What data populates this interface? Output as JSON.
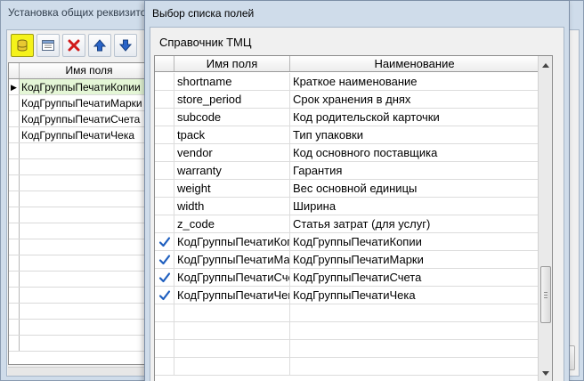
{
  "background_window": {
    "title": "Установка общих реквизито",
    "toolbar": [
      {
        "icon": "database-icon",
        "active": true
      },
      {
        "icon": "form-icon",
        "active": false
      },
      {
        "icon": "delete-icon",
        "active": false
      },
      {
        "icon": "arrow-up-icon",
        "active": false
      },
      {
        "icon": "arrow-down-icon",
        "active": false
      }
    ],
    "grid": {
      "header": "Имя поля",
      "rows": [
        {
          "value": "КодГруппыПечатиКопии",
          "current": true
        },
        {
          "value": "КодГруппыПечатиМарки",
          "current": false
        },
        {
          "value": "КодГруппыПечатиСчета",
          "current": false
        },
        {
          "value": "КодГруппыПечатиЧека",
          "current": false
        }
      ],
      "current_marker": "▶"
    }
  },
  "dialog": {
    "title": "Выбор списка полей",
    "label": "Справочник ТМЦ",
    "columns": {
      "name": "Имя поля",
      "desc": "Наименование"
    },
    "rows": [
      {
        "checked": false,
        "name": "shortname",
        "desc": "Краткое наименование"
      },
      {
        "checked": false,
        "name": "store_period",
        "desc": "Срок хранения в днях"
      },
      {
        "checked": false,
        "name": "subcode",
        "desc": "Код родительской карточки"
      },
      {
        "checked": false,
        "name": "tpack",
        "desc": "Тип упаковки"
      },
      {
        "checked": false,
        "name": "vendor",
        "desc": "Код основного поставщика"
      },
      {
        "checked": false,
        "name": "warranty",
        "desc": "Гарантия"
      },
      {
        "checked": false,
        "name": "weight",
        "desc": "Вес основной единицы"
      },
      {
        "checked": false,
        "name": "width",
        "desc": "Ширина"
      },
      {
        "checked": false,
        "name": "z_code",
        "desc": "Статья затрат (для услуг)"
      },
      {
        "checked": true,
        "name": "КодГруппыПечатиКопии",
        "desc": "КодГруппыПечатиКопии"
      },
      {
        "checked": true,
        "name": "КодГруппыПечатиМарки",
        "desc": "КодГруппыПечатиМарки"
      },
      {
        "checked": true,
        "name": "КодГруппыПечатиСчета",
        "desc": "КодГруппыПечатиСчета"
      },
      {
        "checked": true,
        "name": "КодГруппыПечатиЧека",
        "desc": "КодГруппыПечатиЧека"
      }
    ],
    "check_color": "#1f5fbf"
  }
}
